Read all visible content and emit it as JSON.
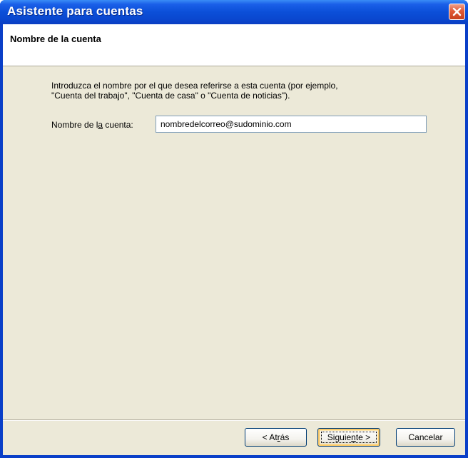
{
  "window": {
    "title": "Asistente para cuentas"
  },
  "header": {
    "title": "Nombre de la cuenta"
  },
  "main": {
    "intro_line1": "Introduzca el nombre por el que desea referirse a esta cuenta (por ejemplo,",
    "intro_line2": "\"Cuenta del trabajo\", \"Cuenta de casa\" o \"Cuenta de noticias\").",
    "field_label_before": "Nombre de l",
    "field_label_accel": "a",
    "field_label_after": " cuenta:",
    "account_name_value": "nombredelcorreo@sudominio.com"
  },
  "footer": {
    "back_pre": "< At",
    "back_accel": "r",
    "back_post": "ás",
    "next_pre": "Siguie",
    "next_accel": "n",
    "next_post": "te >",
    "cancel_label": "Cancelar"
  },
  "colors": {
    "titlebar": "#0a47cf",
    "dialog_face": "#ece9d8",
    "close_button": "#e05a36"
  },
  "icons": {
    "close": "close-x-icon"
  }
}
